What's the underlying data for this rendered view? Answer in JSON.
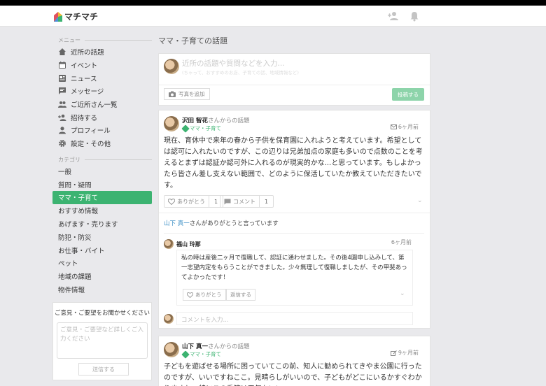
{
  "app": {
    "name": "マチマチ"
  },
  "sidebar": {
    "menu_title": "メニュー",
    "items": [
      {
        "label": "近所の話題",
        "icon": "home-icon"
      },
      {
        "label": "イベント",
        "icon": "calendar-icon"
      },
      {
        "label": "ニュース",
        "icon": "news-icon"
      },
      {
        "label": "メッセージ",
        "icon": "message-icon"
      },
      {
        "label": "ご近所さん一覧",
        "icon": "people-icon"
      },
      {
        "label": "招待する",
        "icon": "invite-icon"
      },
      {
        "label": "プロフィール",
        "icon": "person-icon"
      },
      {
        "label": "設定・その他",
        "icon": "gear-icon"
      }
    ],
    "category_title": "カテゴリ",
    "categories": [
      "一般",
      "質問・疑問",
      "ママ・子育て",
      "おすすめ情報",
      "あげます・売ります",
      "防犯・防災",
      "お仕事・バイト",
      "ペット",
      "地域の課題",
      "物件情報"
    ],
    "active_category": "ママ・子育て",
    "feedback": {
      "title": "ご意見・ご要望をお聞かせください",
      "placeholder": "ご意見・ご要望など詳しくご入力ください",
      "button": "送信する"
    }
  },
  "main": {
    "title": "ママ・子育ての話題",
    "composer": {
      "placeholder": "近所の話題や質問などを入力...",
      "hint": "(ちゃって、おすすめのお店、子育ての話、地域情報など)",
      "photo_button": "写真を追加",
      "submit_button": "投稿する"
    },
    "posts": [
      {
        "author": "沢田 智花",
        "from": "さんからの話題",
        "tag": "ママ・子育て",
        "time": "6ヶ月前",
        "body": "現在、育休中で来年の春から子供を保育園に入れようと考えています。希望としては認可に入れたいのですが、この辺りは兄弟加点の家庭も多いので点数のことを考えるとまずは認証か認可外に入れるのが現実的かな...と思っています。もしよかったら皆さん差し支えない範囲で、どのように保活していたか教えていただきたいです。",
        "thanks_label": "ありがとう",
        "thanks_count": "1",
        "comment_label": "コメント",
        "comment_count": "1",
        "thanks_by": "山下 真一",
        "thanks_suffix": "さんがありがとうと言っています",
        "reply": {
          "author": "福山 玲那",
          "time": "6ヶ月前",
          "body": "私の時は産後二ヶ月で復職して、認証に通わせました。その後4園申し込みして、第一志望内定をもらうことができました。少々無理して復職しましたが、その甲斐あってよかったです！",
          "thanks_label": "ありがとう",
          "reply_label": "返信する"
        },
        "comment_placeholder": "コメントを入力..."
      },
      {
        "author": "山下 真一",
        "from": "さんからの話題",
        "tag": "ママ・子育て",
        "time": "9ヶ月前",
        "body": "子どもを遊ばせる場所に困っていてこの前、知人に勧められてきやま公園に行ったのですが、いいですねここ。見晴らしがいいので、子どもがどこにいるかすぐわかりますし、特にこの季節は天気もいい"
      }
    ]
  }
}
